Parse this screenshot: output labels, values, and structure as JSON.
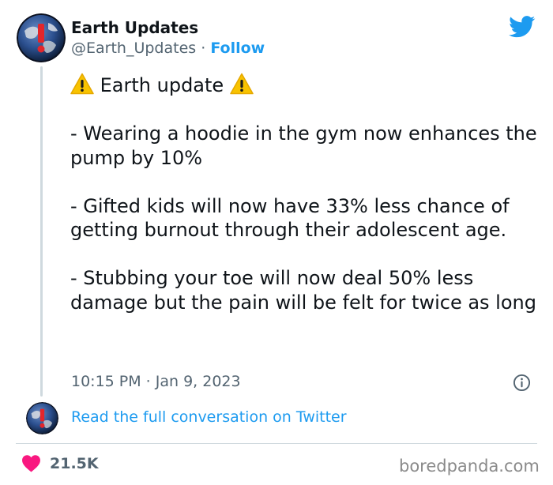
{
  "author": {
    "name": "Earth Updates",
    "handle": "@Earth_Updates",
    "separator": "·",
    "follow_label": "Follow",
    "avatar_icon": "earth-warning-avatar"
  },
  "tweet": {
    "title": "Earth update",
    "paragraphs": [
      "- Wearing a hoodie in the gym now enhances the pump by 10%",
      "- Gifted kids will now have 33% less chance of getting burnout through their adolescent age.",
      "- Stubbing your toe will now deal 50% less damage but the pain will be felt for twice as long"
    ],
    "timestamp": "10:15 PM · Jan 9, 2023"
  },
  "thread": {
    "read_more_label": "Read the full conversation on Twitter"
  },
  "engagement": {
    "likes": "21.5K",
    "like_icon": "heart-icon"
  },
  "watermark": "boredpanda.com",
  "colors": {
    "link": "#1d9bf0",
    "secondary_text": "#536471",
    "heart": "#f91880",
    "twitter_bird": "#1d9bf0",
    "warning": "#f8c300"
  }
}
